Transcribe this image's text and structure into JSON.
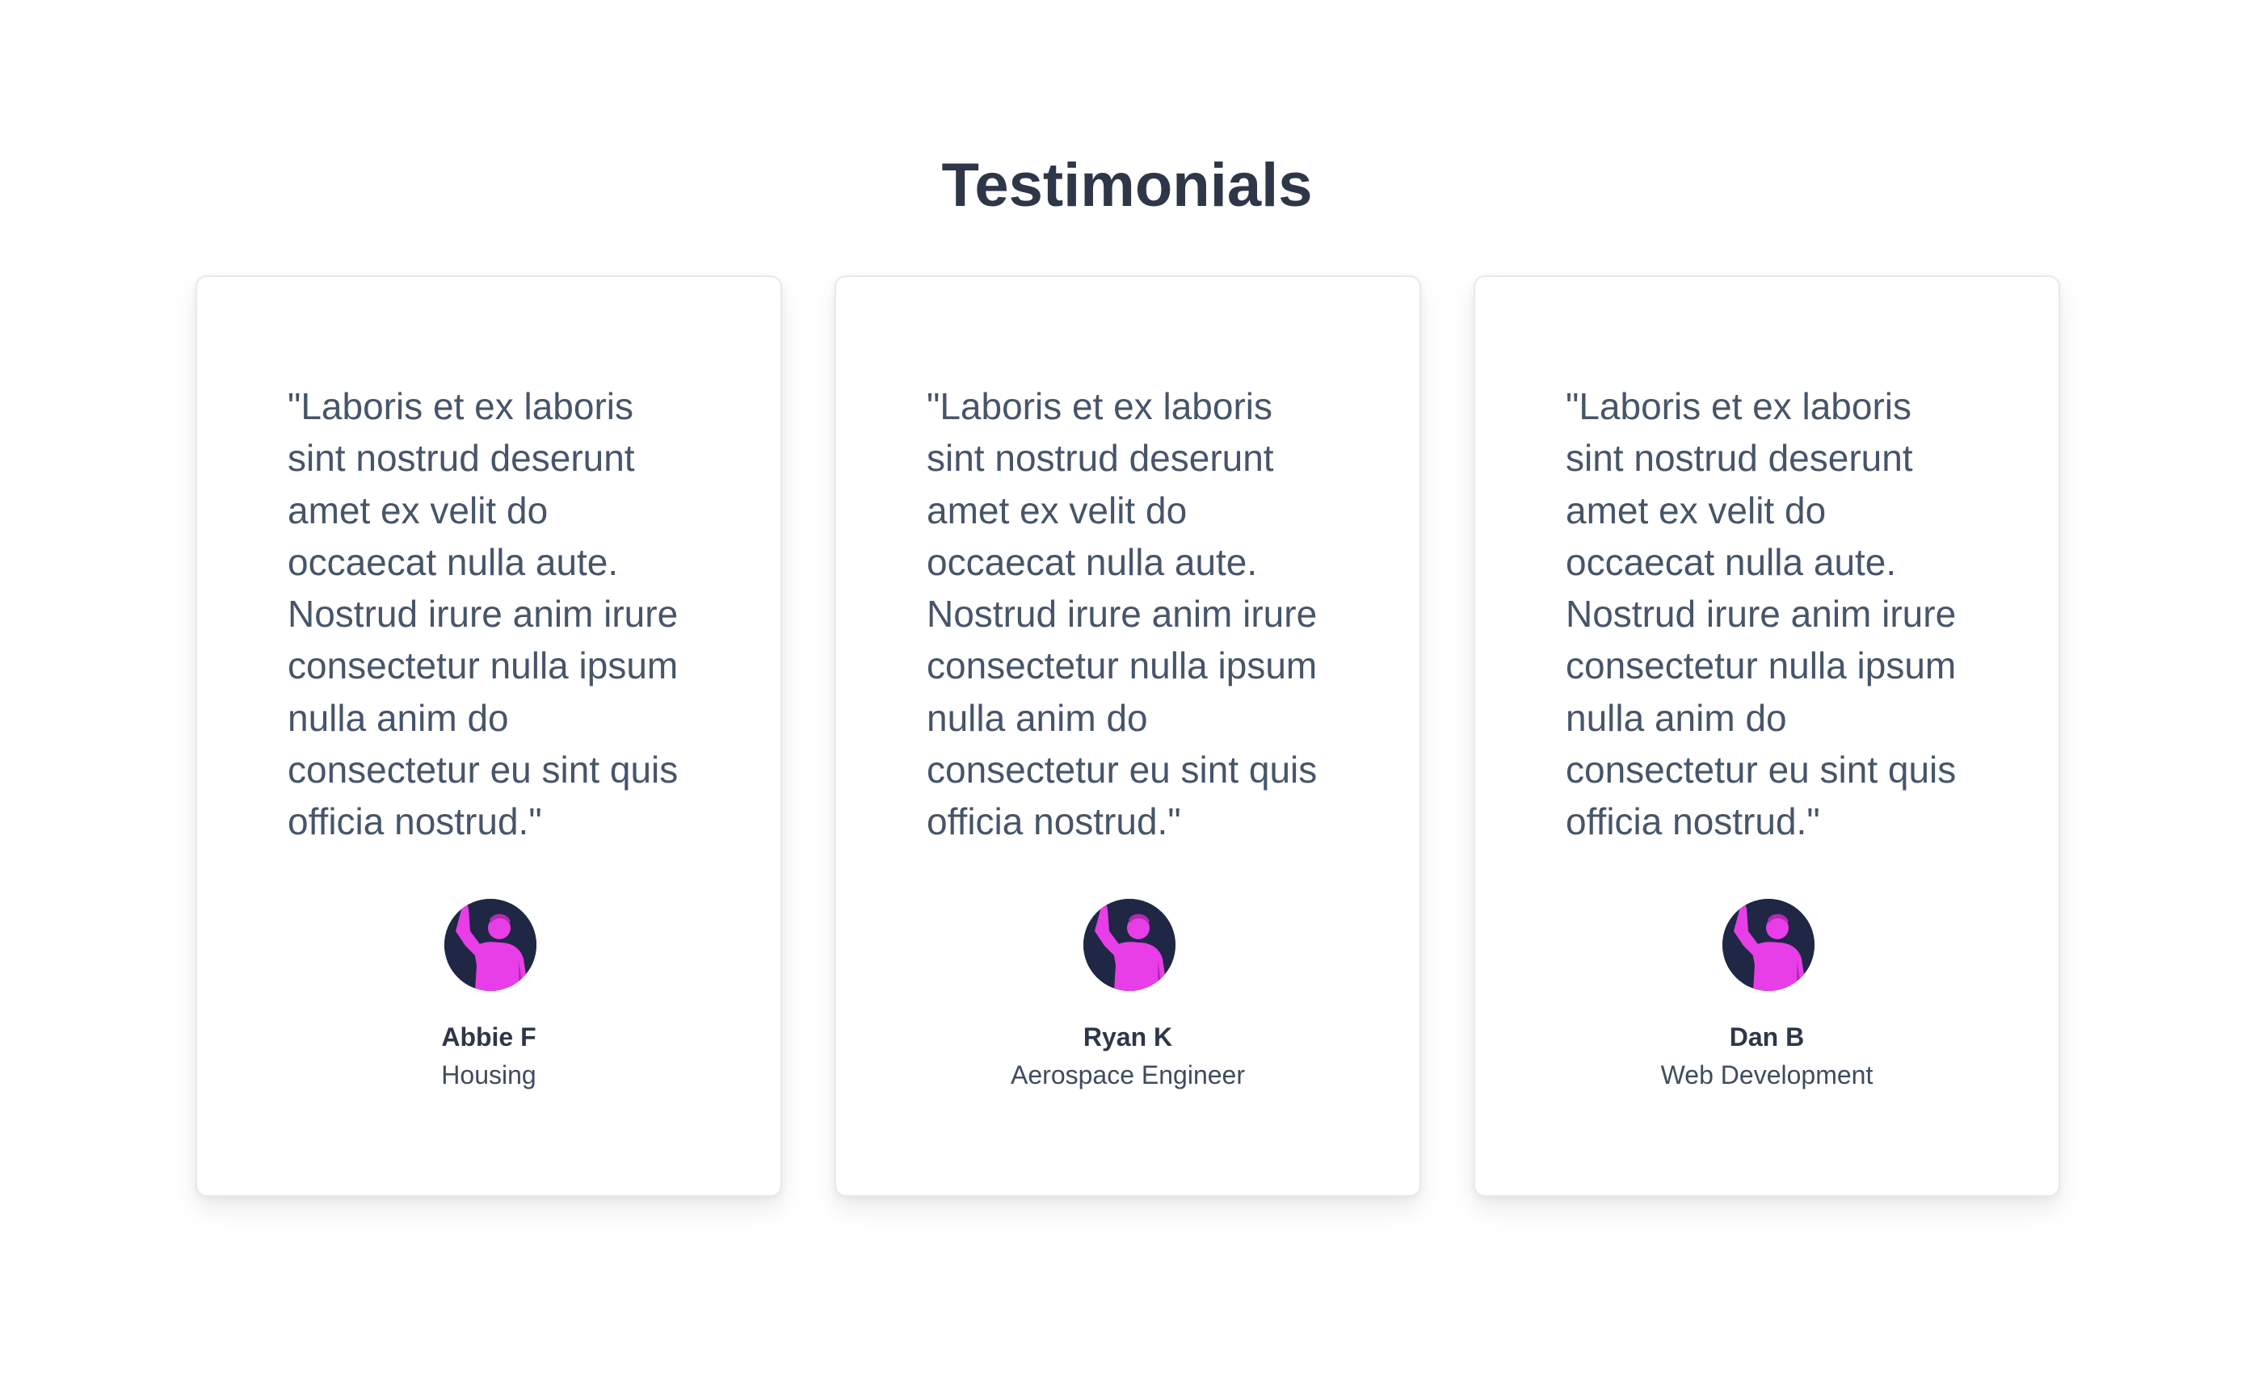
{
  "section": {
    "title": "Testimonials"
  },
  "testimonials": [
    {
      "quote": "\"Laboris et ex laboris sint nostrud deserunt amet ex velit do occaecat nulla aute. Nostrud irure anim irure consectetur nulla ipsum nulla anim do consectetur eu sint quis officia nostrud.\"",
      "name": "Abbie F",
      "role": "Housing",
      "avatar": "person-waving-avatar"
    },
    {
      "quote": "\"Laboris et ex laboris sint nostrud deserunt amet ex velit do occaecat nulla aute. Nostrud irure anim irure consectetur nulla ipsum nulla anim do consectetur eu sint quis officia nostrud.\"",
      "name": "Ryan K",
      "role": "Aerospace Engineer",
      "avatar": "person-waving-avatar"
    },
    {
      "quote": "\"Laboris et ex laboris sint nostrud deserunt amet ex velit do occaecat nulla aute. Nostrud irure anim irure consectetur nulla ipsum nulla anim do consectetur eu sint quis officia nostrud.\"",
      "name": "Dan B",
      "role": "Web Development",
      "avatar": "person-waving-avatar"
    }
  ],
  "colors": {
    "avatar_background": "#1f2744",
    "avatar_figure": "#e83ee8",
    "title_text": "#2d3748",
    "quote_text": "#475569"
  }
}
